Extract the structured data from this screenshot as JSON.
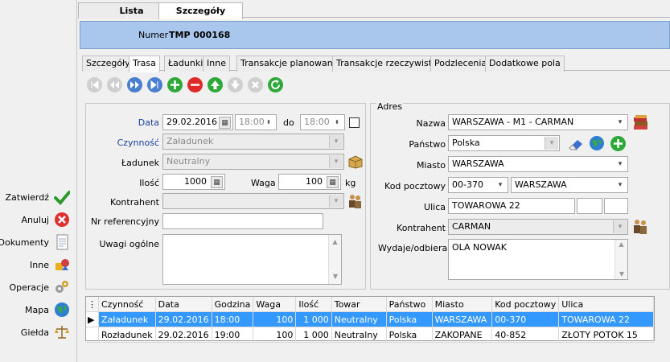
{
  "top_tabs": [
    "Lista",
    "Szczegóły"
  ],
  "header": {
    "numer_label": "Numer",
    "numer_value": "TMP 000168"
  },
  "sub_tabs": [
    "Szczegóły",
    "Trasa",
    "Ładunki",
    "Inne",
    "Transakcje planowane",
    "Transakcje rzeczywiste",
    "Podzlecenia",
    "Dodatkowe pola"
  ],
  "side_menu": [
    {
      "label": "Zatwierdź",
      "icon": "check-icon"
    },
    {
      "label": "Anuluj",
      "icon": "cancel-icon"
    },
    {
      "label": "Dokumenty",
      "icon": "document-icon"
    },
    {
      "label": "Inne",
      "icon": "other-icon"
    },
    {
      "label": "Operacje",
      "icon": "gears-icon"
    },
    {
      "label": "Mapa",
      "icon": "globe-icon"
    },
    {
      "label": "Giełda",
      "icon": "scales-icon"
    }
  ],
  "form": {
    "data_label": "Data",
    "date_value": "29.02.2016",
    "time_from": "18:00",
    "do_label": "do",
    "time_to": "18:00",
    "czynnosc_label": "Czynność",
    "czynnosc_value": "Załadunek",
    "ladunek_label": "Ładunek",
    "ladunek_value": "Neutralny",
    "ilosc_label": "Ilość",
    "ilosc_value": "1000",
    "waga_label": "Waga",
    "waga_value": "100",
    "kg_label": "kg",
    "kontrahent_label": "Kontrahent",
    "kontrahent_value": "",
    "nrref_label": "Nr referencyjny",
    "nrref_value": "",
    "uwagi_label": "Uwagi ogólne",
    "uwagi_value": ""
  },
  "address": {
    "group_label": "Adres",
    "nazwa_label": "Nazwa",
    "nazwa_value": "WARSZAWA - M1 - CARMAN",
    "panstwo_label": "Państwo",
    "panstwo_value": "Polska",
    "miasto_label": "Miasto",
    "miasto_value": "WARSZAWA",
    "kod_label": "Kod pocztowy",
    "kod_value": "00-370",
    "kod_city_value": "WARSZAWA",
    "ulica_label": "Ulica",
    "ulica_value": "TOWAROWA 22",
    "kontrahent_label": "Kontrahent",
    "kontrahent_value": "CARMAN",
    "wydaje_label": "Wydaje/odbiera",
    "wydaje_value": "OLA NOWAK"
  },
  "table": {
    "columns": [
      "Czynność",
      "Data",
      "Godzina",
      "Waga",
      "Ilość",
      "Towar",
      "Państwo",
      "Miasto",
      "Kod pocztowy",
      "Ulica"
    ],
    "rows": [
      [
        "Załadunek",
        "29.02.2016",
        "18:00",
        "100",
        "1 000",
        "Neutralny",
        "Polska",
        "WARSZAWA",
        "00-370",
        "TOWAROWA 22"
      ],
      [
        "Rozładunek",
        "29.02.2016",
        "19:00",
        "100",
        "1 000",
        "Neutralny",
        "Polska",
        "ZAKOPANE",
        "40-852",
        "ZŁOTY POTOK 15"
      ]
    ],
    "selected_row": 0
  },
  "colors": {
    "header_bar": "#a9c7ec",
    "selection": "#3399ff",
    "nav_blue": "#4a7fd0",
    "nav_green": "#2fa83a",
    "nav_red": "#e02a2a"
  }
}
